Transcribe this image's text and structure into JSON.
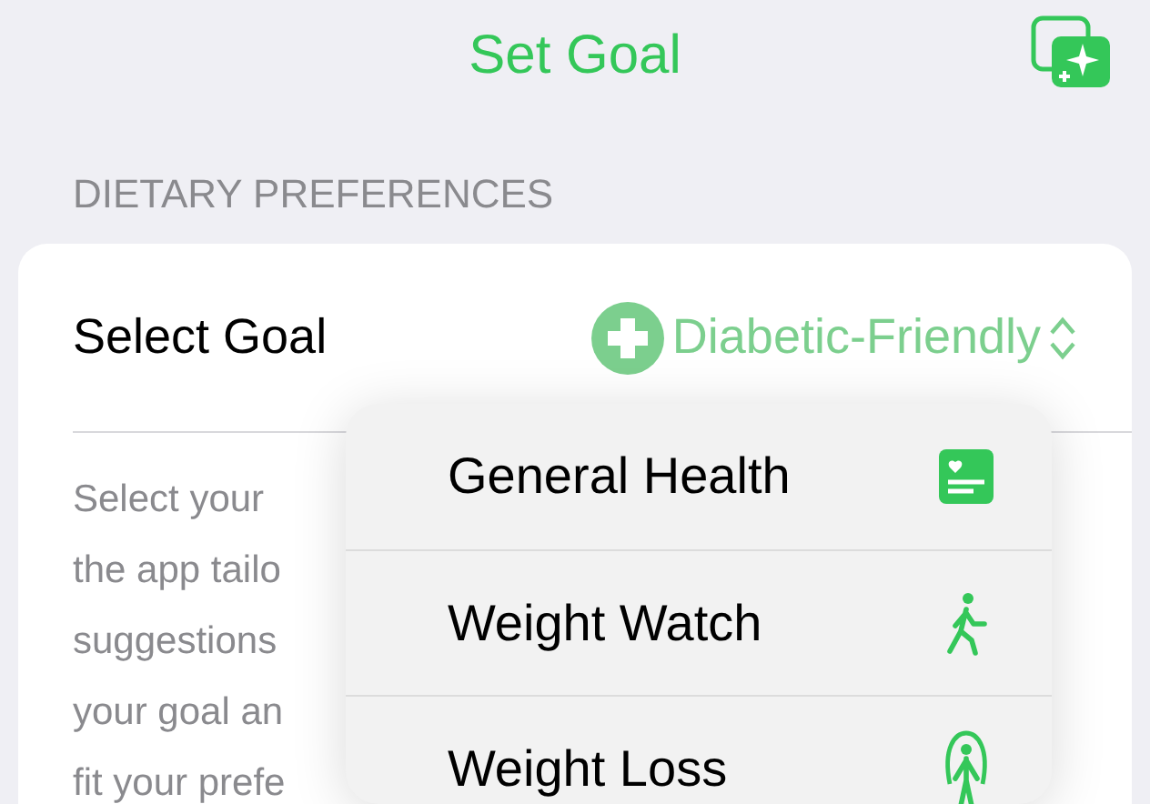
{
  "nav_bar": {
    "title": "Set Goal"
  },
  "section_header": "DIETARY PREFERENCES",
  "goal_row": {
    "label": "Select Goal",
    "value": "Diabetic-Friendly",
    "expanded": true
  },
  "description": "Select your\nthe app tailo\nsuggestions\nyour goal an\nfit your prefe",
  "menu": [
    {
      "label": "General Health",
      "kind": "card"
    },
    {
      "label": "Weight Watch",
      "kind": "walk"
    },
    {
      "label": "Weight Loss",
      "kind": "jump"
    }
  ]
}
